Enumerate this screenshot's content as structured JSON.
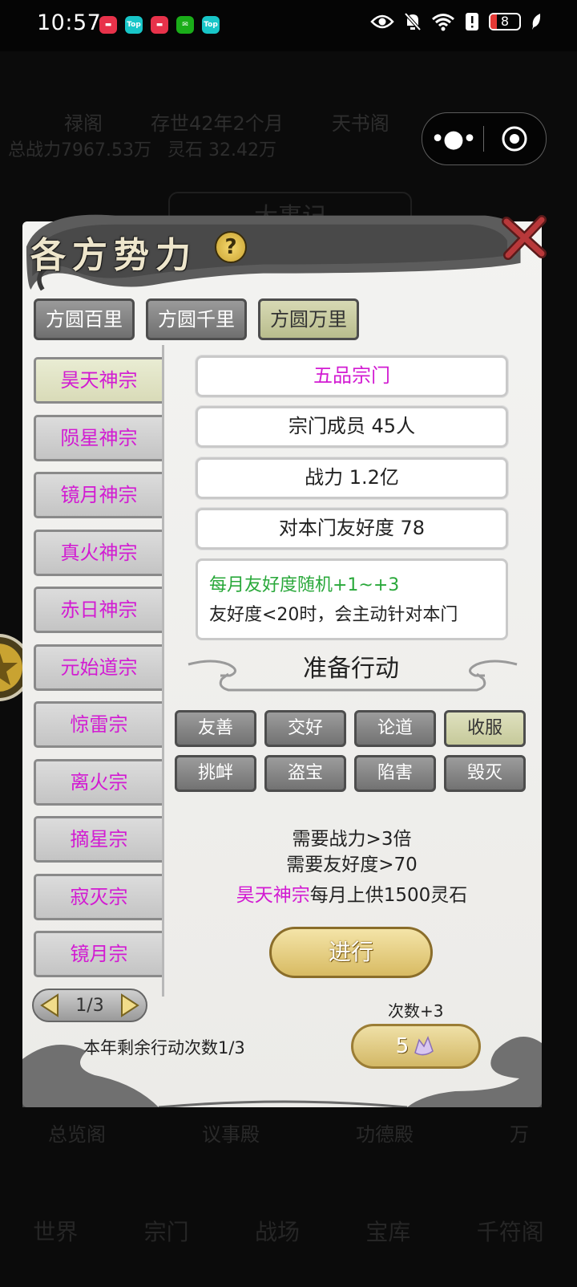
{
  "status_bar": {
    "time": "10:57",
    "app_icons": [
      "ic-red",
      "Top",
      "ic-red",
      "wechat-icon",
      "Top"
    ],
    "battery": "8"
  },
  "background": {
    "top_left": "禄阁",
    "top_mid": "存世42年2个月",
    "top_right": "天书阁",
    "power_line": "总战力7967.53万",
    "stone_line": "灵石 32.42万",
    "title": "大事记",
    "bottom_tabs": [
      "总览阁",
      "议事殿",
      "功德殿",
      "万"
    ],
    "nav": [
      "世界",
      "宗门",
      "战场",
      "宝库",
      "千符阁"
    ]
  },
  "dialog": {
    "title": "各方势力",
    "help": "?",
    "range_tabs": [
      {
        "label": "方圆百里",
        "active": false
      },
      {
        "label": "方圆千里",
        "active": false
      },
      {
        "label": "方圆万里",
        "active": true
      }
    ],
    "sects": [
      {
        "label": "昊天神宗",
        "active": true
      },
      {
        "label": "陨星神宗",
        "active": false
      },
      {
        "label": "镜月神宗",
        "active": false
      },
      {
        "label": "真火神宗",
        "active": false
      },
      {
        "label": "赤日神宗",
        "active": false
      },
      {
        "label": "元始道宗",
        "active": false
      },
      {
        "label": "惊雷宗",
        "active": false
      },
      {
        "label": "离火宗",
        "active": false
      },
      {
        "label": "摘星宗",
        "active": false
      },
      {
        "label": "寂灭宗",
        "active": false
      },
      {
        "label": "镜月宗",
        "active": false
      }
    ],
    "info": {
      "rank": "五品宗门",
      "members": "宗门成员 45人",
      "power": "战力 1.2亿",
      "friendship": "对本门友好度 78",
      "note_green": "每月友好度随机+1~+3",
      "note_black": "友好度<20时，会主动针对本门"
    },
    "prep_title": "准备行动",
    "actions": [
      {
        "label": "友善",
        "active": false
      },
      {
        "label": "交好",
        "active": false
      },
      {
        "label": "论道",
        "active": false
      },
      {
        "label": "收服",
        "active": true
      },
      {
        "label": "挑衅",
        "active": false
      },
      {
        "label": "盗宝",
        "active": false
      },
      {
        "label": "陷害",
        "active": false
      },
      {
        "label": "毁灭",
        "active": false
      }
    ],
    "requirements": {
      "line1": "需要战力>3倍",
      "line2": "需要友好度>70",
      "line3_highlight": "昊天神宗",
      "line3_rest": "每月上供1500灵石"
    },
    "go_button": "进行",
    "pager": "1/3",
    "remaining": "本年剩余行动次数1/3",
    "times_label": "次数+3",
    "buy_amount": "5"
  }
}
